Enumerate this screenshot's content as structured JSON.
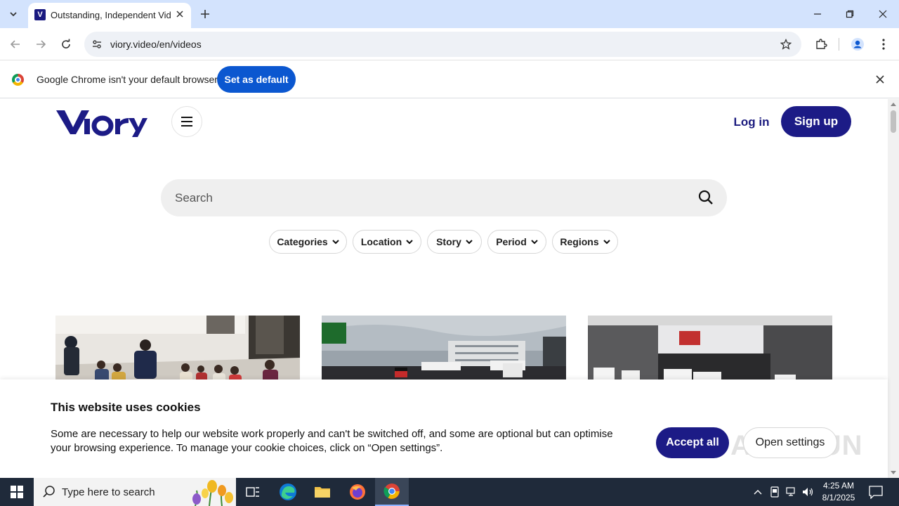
{
  "browser": {
    "tab_title": "Outstanding, Independent Vide",
    "url": "viory.video/en/videos",
    "infobar_text": "Google Chrome isn't your default browser",
    "infobar_button": "Set as default"
  },
  "site": {
    "logo_text": "viory",
    "login_label": "Log in",
    "signup_label": "Sign up",
    "search_placeholder": "Search",
    "filters": [
      "Categories",
      "Location",
      "Story",
      "Period",
      "Regions"
    ],
    "brand_color": "#1c1b86"
  },
  "cookie": {
    "title": "This website uses cookies",
    "text": "Some are necessary to help our website work properly and can't be switched off, and some are optional but can optimise your browsing experience. To manage your cookie choices, click on “Open settings”.",
    "accept_label": "Accept all",
    "settings_label": "Open settings",
    "watermark": "ANY RUN"
  },
  "taskbar": {
    "search_placeholder": "Type here to search",
    "time": "4:25 AM",
    "date": "8/1/2025"
  }
}
